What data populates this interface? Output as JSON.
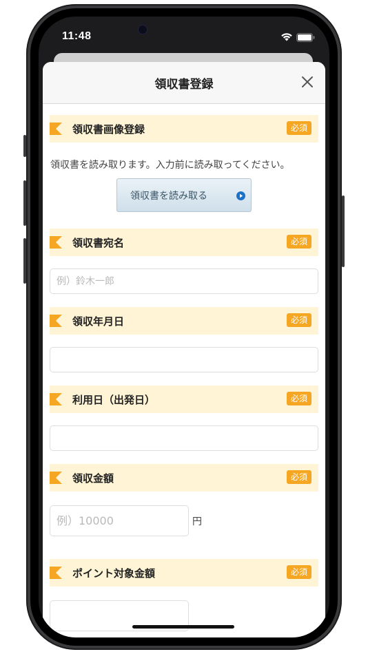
{
  "status_bar": {
    "time": "11:48",
    "icons": [
      "wifi-icon",
      "battery-icon"
    ]
  },
  "modal": {
    "title": "領収書登録",
    "close_icon": "close-icon"
  },
  "required_badge": "必須",
  "sections": {
    "receipt_image": {
      "label": "領収書画像登録",
      "helper": "領収書を読み取ります。入力前に読み取ってください。",
      "button_label": "領収書を読み取る"
    },
    "recipient": {
      "label": "領収書宛名",
      "value": "",
      "placeholder": "例）鈴木一郎"
    },
    "receipt_date": {
      "label": "領収年月日",
      "value": "",
      "placeholder": ""
    },
    "usage_date": {
      "label": "利用日（出発日）",
      "value": "",
      "placeholder": ""
    },
    "receipt_amount": {
      "label": "領収金額",
      "value": "",
      "placeholder": "例）10000",
      "unit": "円"
    },
    "points_amount": {
      "label": "ポイント対象金額",
      "value": "",
      "placeholder": ""
    }
  },
  "colors": {
    "accent": "#f5a623",
    "section_bg": "#fff5d6",
    "button_bg": "#dbe8f0",
    "play_icon": "#1a73c9"
  }
}
